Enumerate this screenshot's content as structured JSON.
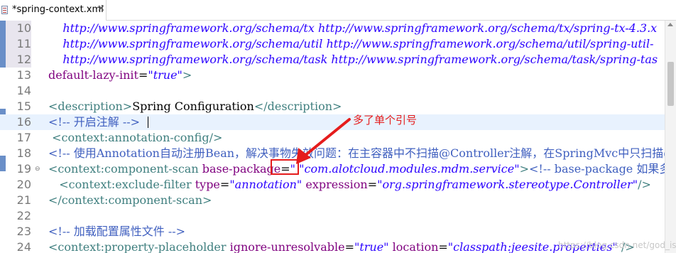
{
  "tab": {
    "title": "*spring-context.xml",
    "close": "✕"
  },
  "lines": [
    {
      "n": "10",
      "parts": [
        [
          "val",
          "    http://www.springframework.org/schema/tx http://www.springframework.org/schema/tx/spring-tx-4.3.x"
        ]
      ]
    },
    {
      "n": "11",
      "parts": [
        [
          "val",
          "    http://www.springframework.org/schema/util http://www.springframework.org/schema/util/spring-util-"
        ]
      ]
    },
    {
      "n": "12",
      "parts": [
        [
          "val",
          "    http://www.springframework.org/schema/task http://www.springframework.org/schema/task/spring-tas"
        ]
      ]
    },
    {
      "n": "13",
      "parts": [
        [
          "attr",
          "default-lazy-init"
        ],
        [
          "txt",
          "="
        ],
        [
          "val",
          "\"true\""
        ],
        [
          "tag",
          ">"
        ]
      ]
    },
    {
      "n": "14",
      "parts": []
    },
    {
      "n": "15",
      "parts": [
        [
          "tag",
          "<description>"
        ],
        [
          "txt",
          "Spring Configuration"
        ],
        [
          "tag",
          "</description>"
        ]
      ]
    },
    {
      "n": "16",
      "parts": [
        [
          "cmt",
          "<!-- 开启注解 -->"
        ]
      ]
    },
    {
      "n": "17",
      "parts": [
        [
          "tag",
          " <context:annotation-config/>"
        ]
      ]
    },
    {
      "n": "18",
      "parts": [
        [
          "cmt",
          "<!-- 使用Annotation自动注册Bean，解决事物失效问题：在主容器中不扫描@Controller注解，在SpringMvc中只扫描@"
        ]
      ]
    },
    {
      "n": "19",
      "parts": [
        [
          "tag",
          "<context:component-scan "
        ],
        [
          "attr",
          "base-package"
        ],
        [
          "txt",
          "="
        ],
        [
          "val",
          "\" \"com.alotcloud.modules.mdm.service\""
        ],
        [
          "tag",
          ">"
        ],
        [
          "cmt",
          "<!-- base-package 如果多个，"
        ]
      ]
    },
    {
      "n": "20",
      "parts": [
        [
          "tag",
          "   <context:exclude-filter "
        ],
        [
          "attr",
          "type"
        ],
        [
          "txt",
          "="
        ],
        [
          "val",
          "\"annotation\""
        ],
        [
          "txt",
          " "
        ],
        [
          "attr",
          "expression"
        ],
        [
          "txt",
          "="
        ],
        [
          "val",
          "\"org.springframework.stereotype.Controller\""
        ],
        [
          "tag",
          "/>"
        ]
      ]
    },
    {
      "n": "21",
      "parts": [
        [
          "tag",
          "</context:component-scan>"
        ]
      ]
    },
    {
      "n": "22",
      "parts": []
    },
    {
      "n": "23",
      "parts": [
        [
          "cmt",
          "<!-- 加载配置属性文件 -->"
        ]
      ]
    },
    {
      "n": "24",
      "parts": [
        [
          "tag",
          "<context:property-placeholder "
        ],
        [
          "attr",
          "ignore-unresolvable"
        ],
        [
          "txt",
          "="
        ],
        [
          "val",
          "\"true\""
        ],
        [
          "txt",
          " "
        ],
        [
          "attr",
          "location"
        ],
        [
          "txt",
          "="
        ],
        [
          "val",
          "\"classpath:jeesite.properties\""
        ],
        [
          "tag",
          " />"
        ]
      ]
    }
  ],
  "annotation": {
    "text": "多了单个引号",
    "color": "#e51c1c"
  },
  "watermark": "https://blog.csdn.net/god_is_girl",
  "colors": {
    "tag": "#3f7f7f",
    "attr": "#7f007f",
    "value": "#2a00ff",
    "comment": "#3f5fbf"
  }
}
